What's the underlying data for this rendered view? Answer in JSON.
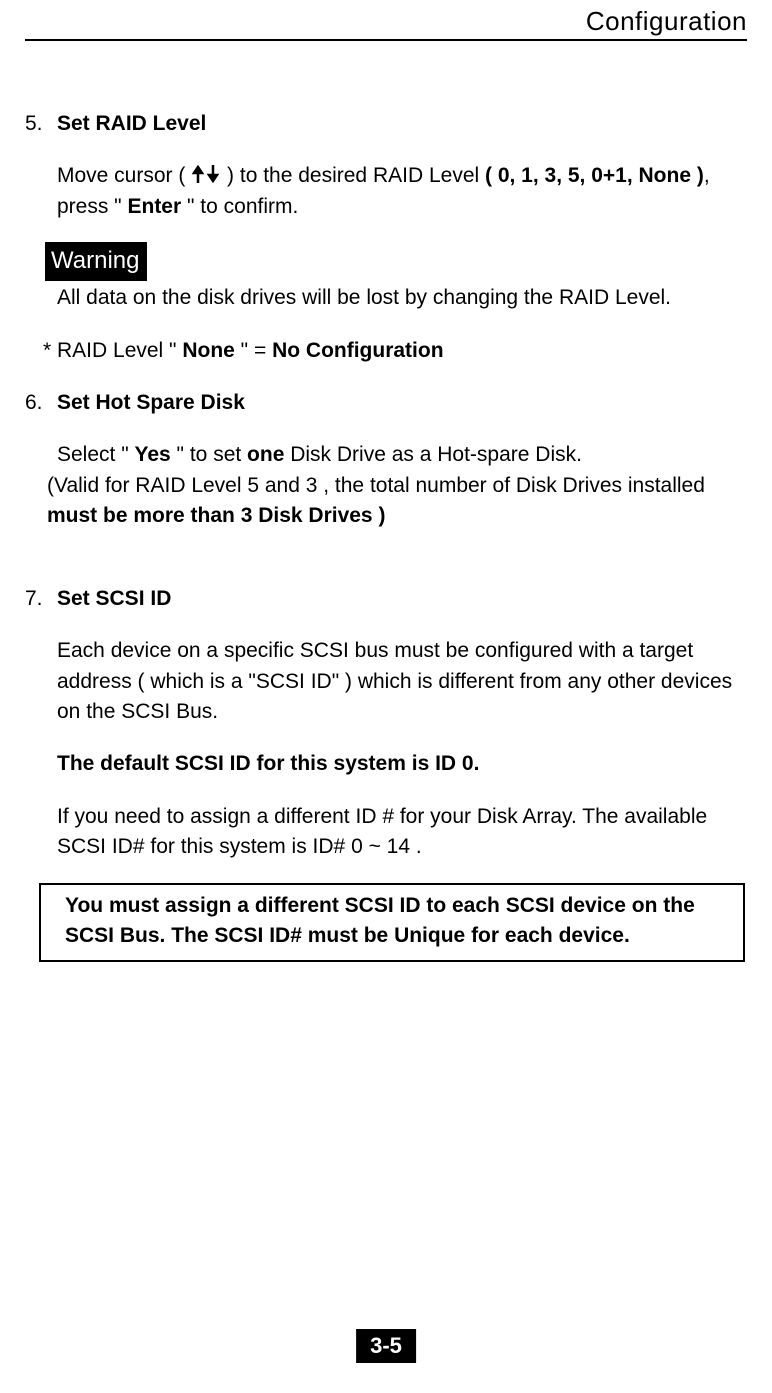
{
  "header": {
    "title": "Configuration"
  },
  "s5": {
    "num": "5.",
    "title": "Set RAID Level",
    "p1a": "Move cursor ( ",
    "p1b": " ) to the desired RAID Level ",
    "p1c": "( 0, 1, 3, 5, 0+1, None )",
    "p1d": ", press \" ",
    "p1e": "Enter",
    "p1f": " \" to confirm.",
    "warn_label": "Warning",
    "warn_text": "All data on the disk drives will be lost by changing the RAID Level.",
    "none_a": "* RAID Level \" ",
    "none_b": "None",
    "none_c": " \"   =   ",
    "none_d": "No Configuration"
  },
  "s6": {
    "num": "6.",
    "title": "Set Hot Spare Disk",
    "p1a": "Select \" ",
    "p1b": "Yes",
    "p1c": " \" to set ",
    "p1d": "one",
    "p1e": " Disk Drive as a Hot-spare Disk.",
    "p2a": "(Valid for RAID Level 5 and 3 , the total number of Disk Drives installed ",
    "p2b": "must be more than 3 Disk Drives )"
  },
  "s7": {
    "num": "7.",
    "title": "Set SCSI ID",
    "p1": "Each device on a specific SCSI bus must be configured with a target address ( which is a \"SCSI ID\" ) which is different from any other devices on the SCSI Bus.",
    "p2": "The default SCSI ID for this system is ID 0.",
    "p3": "If you need to assign a different ID # for your Disk Array. The available SCSI ID# for this system is ID# 0 ~ 14 .",
    "box": "You must assign a different SCSI ID to each SCSI device on the SCSI Bus. The SCSI ID# must be Unique for each device."
  },
  "pageno": "3-5"
}
